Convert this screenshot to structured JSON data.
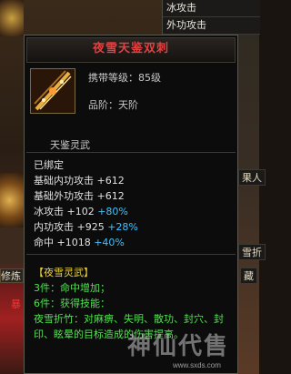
{
  "side_panel": {
    "rows": [
      "冰攻击",
      "外功攻击"
    ]
  },
  "side_right_items": [
    "果人",
    "雪折",
    "藏"
  ],
  "bottom_left_label": "修炼",
  "bottom_left_tag": "暴",
  "tooltip": {
    "title": "夜雪天鉴双刺",
    "require_level": "携带等级：85级",
    "grade": "品阶：天阶",
    "sub_name": "天鉴灵武",
    "bound": "已绑定",
    "stats": [
      {
        "label": "基础内功攻击",
        "value": "+612",
        "bonus": ""
      },
      {
        "label": "基础外功攻击",
        "value": "+612",
        "bonus": ""
      },
      {
        "label": "冰攻击",
        "value": "+102",
        "bonus": "+80%"
      },
      {
        "label": "内功攻击",
        "value": "+925",
        "bonus": "+28%"
      },
      {
        "label": "命中",
        "value": "+1018",
        "bonus": "+40%"
      }
    ],
    "set_name": "【夜雪灵武】",
    "set_3": "3件：命中增加；",
    "set_6": "6件：获得技能：",
    "set_skill": "夜雪折竹：对麻痹、失明、散功、封穴、封印、眩晕的目标造成的伤害提高。"
  },
  "watermark": {
    "logo": "神仙代售",
    "url": "www.sxds.com"
  },
  "colors": {
    "title": "#e04040",
    "blue_bonus": "#40c0ff",
    "green_text": "#50e050",
    "set_name": "#e8d040"
  }
}
